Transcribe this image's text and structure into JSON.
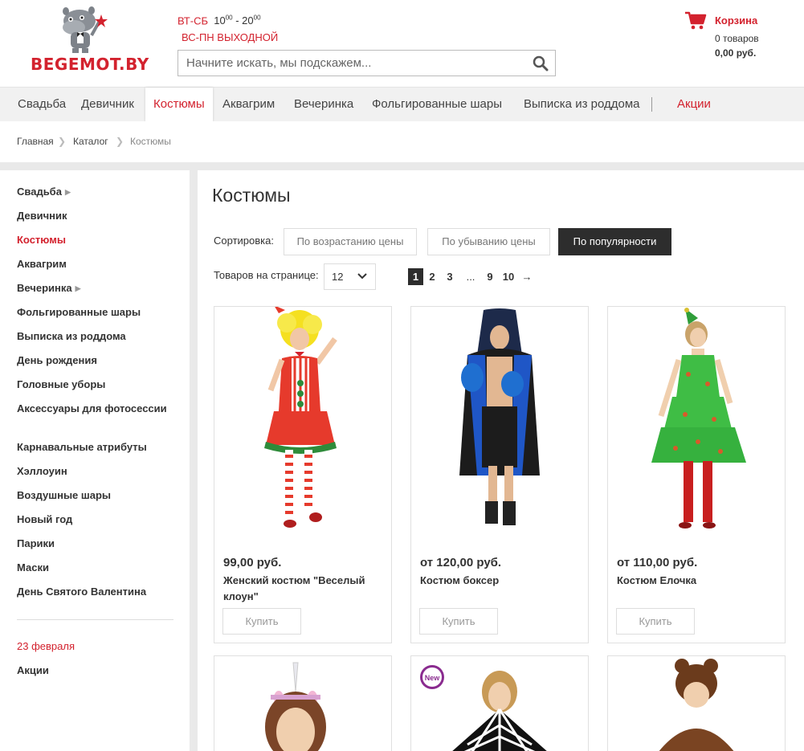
{
  "header": {
    "logo_text": "BEGEMOT.BY",
    "hours_days1": "ВТ-СБ",
    "hours_time1": "10",
    "hours_sup1": "00",
    "hours_dash": " - 20",
    "hours_sup2": "00",
    "hours_days2": "ВС-ПН ВЫХОДНОЙ",
    "search_placeholder": "Начните искать, мы подскажем...",
    "cart_title": "Корзина",
    "cart_count": "0 товаров",
    "cart_sum": "0,00 руб."
  },
  "topnav": {
    "items": [
      "Свадьба",
      "Девичник",
      "Костюмы",
      "Аквагрим",
      "Вечеринка",
      "Фольгированные шары",
      "Выписка из роддома",
      "Акции"
    ]
  },
  "breadcrumb": {
    "items": [
      "Главная",
      "Каталог",
      "Костюмы"
    ]
  },
  "sidebar": {
    "items": [
      "Свадьба",
      "Девичник",
      "Костюмы",
      "Аквагрим",
      "Вечеринка",
      "Фольгированные шары",
      "Выписка из роддома",
      "День рождения",
      "Головные уборы",
      "Аксессуары для фотосессии",
      "Карнавальные атрибуты",
      "Хэллоуин",
      "Воздушные шары",
      "Новый год",
      "Парики",
      "Маски",
      "День Святого Валентина"
    ],
    "holiday": "23 февраля",
    "promo": "Акции"
  },
  "main": {
    "title": "Костюмы",
    "sort_label": "Сортировка:",
    "sort_options": [
      "По возрастанию цены",
      "По убыванию цены",
      "По популярности"
    ],
    "per_page_label": "Товаров на странице:",
    "per_page_value": "12",
    "pages": [
      "1",
      "2",
      "3",
      "...",
      "9",
      "10",
      "→"
    ]
  },
  "products": [
    {
      "price": "99,00 руб.",
      "name": "Женский костюм \"Веселый клоун\"",
      "buy": "Купить"
    },
    {
      "price": "от 120,00 руб.",
      "name": "Костюм боксер",
      "buy": "Купить"
    },
    {
      "price": "от 110,00 руб.",
      "name": "Костюм Елочка",
      "buy": "Купить"
    }
  ],
  "badges": {
    "new": "New"
  },
  "colors": {
    "accent": "#d3222e",
    "dark": "#2d2d2d"
  }
}
